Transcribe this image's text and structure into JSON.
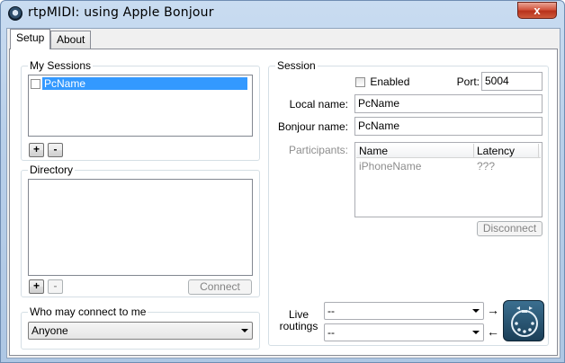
{
  "window": {
    "title": "rtpMIDI: using Apple Bonjour",
    "close_glyph": "x"
  },
  "tabs": [
    {
      "label": "Setup",
      "active": true
    },
    {
      "label": "About",
      "active": false
    }
  ],
  "my_sessions": {
    "legend": "My Sessions",
    "items": [
      {
        "name": "PcName",
        "checked": false,
        "selected": true
      }
    ],
    "add_label": "+",
    "remove_label": "-"
  },
  "directory": {
    "legend": "Directory",
    "items": [],
    "add_label": "+",
    "remove_label": "-",
    "connect_label": "Connect"
  },
  "who_may_connect": {
    "legend": "Who may connect to me",
    "selected": "Anyone"
  },
  "session": {
    "legend": "Session",
    "enabled_label": "Enabled",
    "enabled_checked": false,
    "port_label": "Port:",
    "port_value": "5004",
    "local_name_label": "Local name:",
    "local_name_value": "PcName",
    "bonjour_name_label": "Bonjour name:",
    "bonjour_name_value": "PcName",
    "participants_label": "Participants:",
    "participants_columns": [
      "Name",
      "Latency"
    ],
    "participants": [
      {
        "name": "iPhoneName",
        "latency": "???"
      }
    ],
    "disconnect_label": "Disconnect"
  },
  "live_routings": {
    "label": "Live\nroutings",
    "out_value": "--",
    "in_value": "--",
    "out_arrow": "→",
    "in_arrow": "←"
  },
  "colors": {
    "selection": "#3399ff",
    "close_button": "#c8432a",
    "group_border": "#d5dfe5"
  }
}
